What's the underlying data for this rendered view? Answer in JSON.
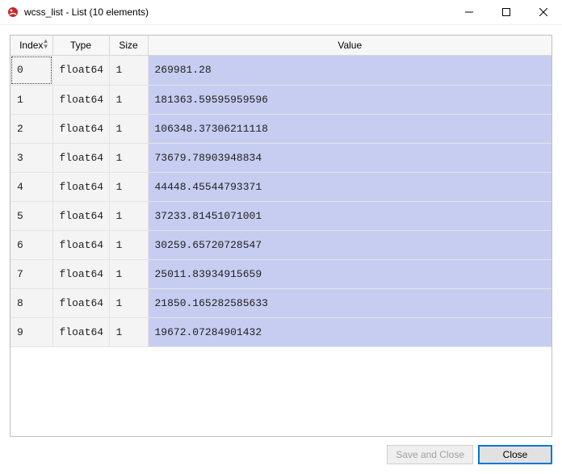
{
  "window": {
    "title": "wcss_list - List (10 elements)"
  },
  "table": {
    "headers": {
      "index": "Index",
      "type": "Type",
      "size": "Size",
      "value": "Value"
    },
    "rows": [
      {
        "index": "0",
        "type": "float64",
        "size": "1",
        "value": "269981.28"
      },
      {
        "index": "1",
        "type": "float64",
        "size": "1",
        "value": "181363.59595959596"
      },
      {
        "index": "2",
        "type": "float64",
        "size": "1",
        "value": "106348.37306211118"
      },
      {
        "index": "3",
        "type": "float64",
        "size": "1",
        "value": "73679.78903948834"
      },
      {
        "index": "4",
        "type": "float64",
        "size": "1",
        "value": "44448.45544793371"
      },
      {
        "index": "5",
        "type": "float64",
        "size": "1",
        "value": "37233.81451071001"
      },
      {
        "index": "6",
        "type": "float64",
        "size": "1",
        "value": "30259.65720728547"
      },
      {
        "index": "7",
        "type": "float64",
        "size": "1",
        "value": "25011.83934915659"
      },
      {
        "index": "8",
        "type": "float64",
        "size": "1",
        "value": "21850.165282585633"
      },
      {
        "index": "9",
        "type": "float64",
        "size": "1",
        "value": "19672.07284901432"
      }
    ],
    "selected_row": 0
  },
  "footer": {
    "save_and_close": "Save and Close",
    "close": "Close"
  }
}
